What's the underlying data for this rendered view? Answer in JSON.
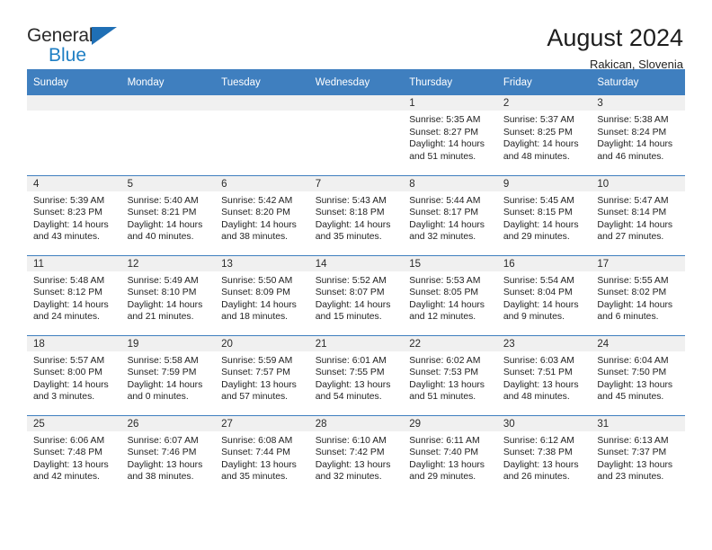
{
  "logo": {
    "line1": "General",
    "line2": "Blue",
    "triangle_color": "#1f6fb5"
  },
  "header": {
    "title": "August 2024",
    "subtitle": "Rakican, Slovenia",
    "accent_color": "#3f7fbf"
  },
  "weekday_headers": [
    "Sunday",
    "Monday",
    "Tuesday",
    "Wednesday",
    "Thursday",
    "Friday",
    "Saturday"
  ],
  "labels": {
    "sunrise": "Sunrise:",
    "sunset": "Sunset:",
    "daylight": "Daylight:"
  },
  "weeks": [
    [
      {
        "empty": true
      },
      {
        "empty": true
      },
      {
        "empty": true
      },
      {
        "empty": true
      },
      {
        "day": "1",
        "sunrise": "Sunrise: 5:35 AM",
        "sunset": "Sunset: 8:27 PM",
        "daylight1": "Daylight: 14 hours",
        "daylight2": "and 51 minutes."
      },
      {
        "day": "2",
        "sunrise": "Sunrise: 5:37 AM",
        "sunset": "Sunset: 8:25 PM",
        "daylight1": "Daylight: 14 hours",
        "daylight2": "and 48 minutes."
      },
      {
        "day": "3",
        "sunrise": "Sunrise: 5:38 AM",
        "sunset": "Sunset: 8:24 PM",
        "daylight1": "Daylight: 14 hours",
        "daylight2": "and 46 minutes."
      }
    ],
    [
      {
        "day": "4",
        "sunrise": "Sunrise: 5:39 AM",
        "sunset": "Sunset: 8:23 PM",
        "daylight1": "Daylight: 14 hours",
        "daylight2": "and 43 minutes."
      },
      {
        "day": "5",
        "sunrise": "Sunrise: 5:40 AM",
        "sunset": "Sunset: 8:21 PM",
        "daylight1": "Daylight: 14 hours",
        "daylight2": "and 40 minutes."
      },
      {
        "day": "6",
        "sunrise": "Sunrise: 5:42 AM",
        "sunset": "Sunset: 8:20 PM",
        "daylight1": "Daylight: 14 hours",
        "daylight2": "and 38 minutes."
      },
      {
        "day": "7",
        "sunrise": "Sunrise: 5:43 AM",
        "sunset": "Sunset: 8:18 PM",
        "daylight1": "Daylight: 14 hours",
        "daylight2": "and 35 minutes."
      },
      {
        "day": "8",
        "sunrise": "Sunrise: 5:44 AM",
        "sunset": "Sunset: 8:17 PM",
        "daylight1": "Daylight: 14 hours",
        "daylight2": "and 32 minutes."
      },
      {
        "day": "9",
        "sunrise": "Sunrise: 5:45 AM",
        "sunset": "Sunset: 8:15 PM",
        "daylight1": "Daylight: 14 hours",
        "daylight2": "and 29 minutes."
      },
      {
        "day": "10",
        "sunrise": "Sunrise: 5:47 AM",
        "sunset": "Sunset: 8:14 PM",
        "daylight1": "Daylight: 14 hours",
        "daylight2": "and 27 minutes."
      }
    ],
    [
      {
        "day": "11",
        "sunrise": "Sunrise: 5:48 AM",
        "sunset": "Sunset: 8:12 PM",
        "daylight1": "Daylight: 14 hours",
        "daylight2": "and 24 minutes."
      },
      {
        "day": "12",
        "sunrise": "Sunrise: 5:49 AM",
        "sunset": "Sunset: 8:10 PM",
        "daylight1": "Daylight: 14 hours",
        "daylight2": "and 21 minutes."
      },
      {
        "day": "13",
        "sunrise": "Sunrise: 5:50 AM",
        "sunset": "Sunset: 8:09 PM",
        "daylight1": "Daylight: 14 hours",
        "daylight2": "and 18 minutes."
      },
      {
        "day": "14",
        "sunrise": "Sunrise: 5:52 AM",
        "sunset": "Sunset: 8:07 PM",
        "daylight1": "Daylight: 14 hours",
        "daylight2": "and 15 minutes."
      },
      {
        "day": "15",
        "sunrise": "Sunrise: 5:53 AM",
        "sunset": "Sunset: 8:05 PM",
        "daylight1": "Daylight: 14 hours",
        "daylight2": "and 12 minutes."
      },
      {
        "day": "16",
        "sunrise": "Sunrise: 5:54 AM",
        "sunset": "Sunset: 8:04 PM",
        "daylight1": "Daylight: 14 hours",
        "daylight2": "and 9 minutes."
      },
      {
        "day": "17",
        "sunrise": "Sunrise: 5:55 AM",
        "sunset": "Sunset: 8:02 PM",
        "daylight1": "Daylight: 14 hours",
        "daylight2": "and 6 minutes."
      }
    ],
    [
      {
        "day": "18",
        "sunrise": "Sunrise: 5:57 AM",
        "sunset": "Sunset: 8:00 PM",
        "daylight1": "Daylight: 14 hours",
        "daylight2": "and 3 minutes."
      },
      {
        "day": "19",
        "sunrise": "Sunrise: 5:58 AM",
        "sunset": "Sunset: 7:59 PM",
        "daylight1": "Daylight: 14 hours",
        "daylight2": "and 0 minutes."
      },
      {
        "day": "20",
        "sunrise": "Sunrise: 5:59 AM",
        "sunset": "Sunset: 7:57 PM",
        "daylight1": "Daylight: 13 hours",
        "daylight2": "and 57 minutes."
      },
      {
        "day": "21",
        "sunrise": "Sunrise: 6:01 AM",
        "sunset": "Sunset: 7:55 PM",
        "daylight1": "Daylight: 13 hours",
        "daylight2": "and 54 minutes."
      },
      {
        "day": "22",
        "sunrise": "Sunrise: 6:02 AM",
        "sunset": "Sunset: 7:53 PM",
        "daylight1": "Daylight: 13 hours",
        "daylight2": "and 51 minutes."
      },
      {
        "day": "23",
        "sunrise": "Sunrise: 6:03 AM",
        "sunset": "Sunset: 7:51 PM",
        "daylight1": "Daylight: 13 hours",
        "daylight2": "and 48 minutes."
      },
      {
        "day": "24",
        "sunrise": "Sunrise: 6:04 AM",
        "sunset": "Sunset: 7:50 PM",
        "daylight1": "Daylight: 13 hours",
        "daylight2": "and 45 minutes."
      }
    ],
    [
      {
        "day": "25",
        "sunrise": "Sunrise: 6:06 AM",
        "sunset": "Sunset: 7:48 PM",
        "daylight1": "Daylight: 13 hours",
        "daylight2": "and 42 minutes."
      },
      {
        "day": "26",
        "sunrise": "Sunrise: 6:07 AM",
        "sunset": "Sunset: 7:46 PM",
        "daylight1": "Daylight: 13 hours",
        "daylight2": "and 38 minutes."
      },
      {
        "day": "27",
        "sunrise": "Sunrise: 6:08 AM",
        "sunset": "Sunset: 7:44 PM",
        "daylight1": "Daylight: 13 hours",
        "daylight2": "and 35 minutes."
      },
      {
        "day": "28",
        "sunrise": "Sunrise: 6:10 AM",
        "sunset": "Sunset: 7:42 PM",
        "daylight1": "Daylight: 13 hours",
        "daylight2": "and 32 minutes."
      },
      {
        "day": "29",
        "sunrise": "Sunrise: 6:11 AM",
        "sunset": "Sunset: 7:40 PM",
        "daylight1": "Daylight: 13 hours",
        "daylight2": "and 29 minutes."
      },
      {
        "day": "30",
        "sunrise": "Sunrise: 6:12 AM",
        "sunset": "Sunset: 7:38 PM",
        "daylight1": "Daylight: 13 hours",
        "daylight2": "and 26 minutes."
      },
      {
        "day": "31",
        "sunrise": "Sunrise: 6:13 AM",
        "sunset": "Sunset: 7:37 PM",
        "daylight1": "Daylight: 13 hours",
        "daylight2": "and 23 minutes."
      }
    ]
  ]
}
